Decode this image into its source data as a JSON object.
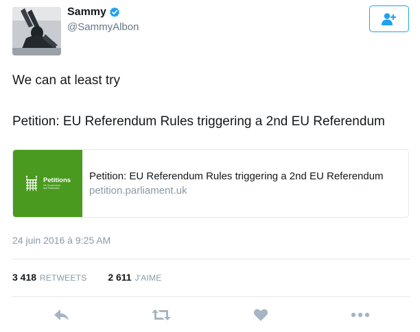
{
  "author": {
    "display_name": "Sammy",
    "handle": "@SammyAlbon",
    "verified": true
  },
  "follow_button": {
    "icon": "add-user-icon"
  },
  "tweet": {
    "line1": "We can at least try",
    "line2": "Petition: EU Referendum Rules triggering a 2nd EU Referendum"
  },
  "card": {
    "logo_title": "Petitions",
    "logo_subtitle_1": "UK Government",
    "logo_subtitle_2": "and Parliament",
    "title": "Petition: EU Referendum Rules triggering a 2nd EU Referendum",
    "domain": "petition.parliament.uk"
  },
  "timestamp": "24 juin 2016 à 9:25 AM",
  "stats": {
    "retweets_count": "3 418",
    "retweets_label": "RETWEETS",
    "likes_count": "2 611",
    "likes_label": "J'AIME"
  },
  "actions": [
    "reply-icon",
    "retweet-icon",
    "heart-icon",
    "more-icon"
  ],
  "colors": {
    "accent": "#1da1f2",
    "muted": "#8899a6",
    "icon": "#a6b5c1",
    "card_green": "#4a9a20"
  }
}
